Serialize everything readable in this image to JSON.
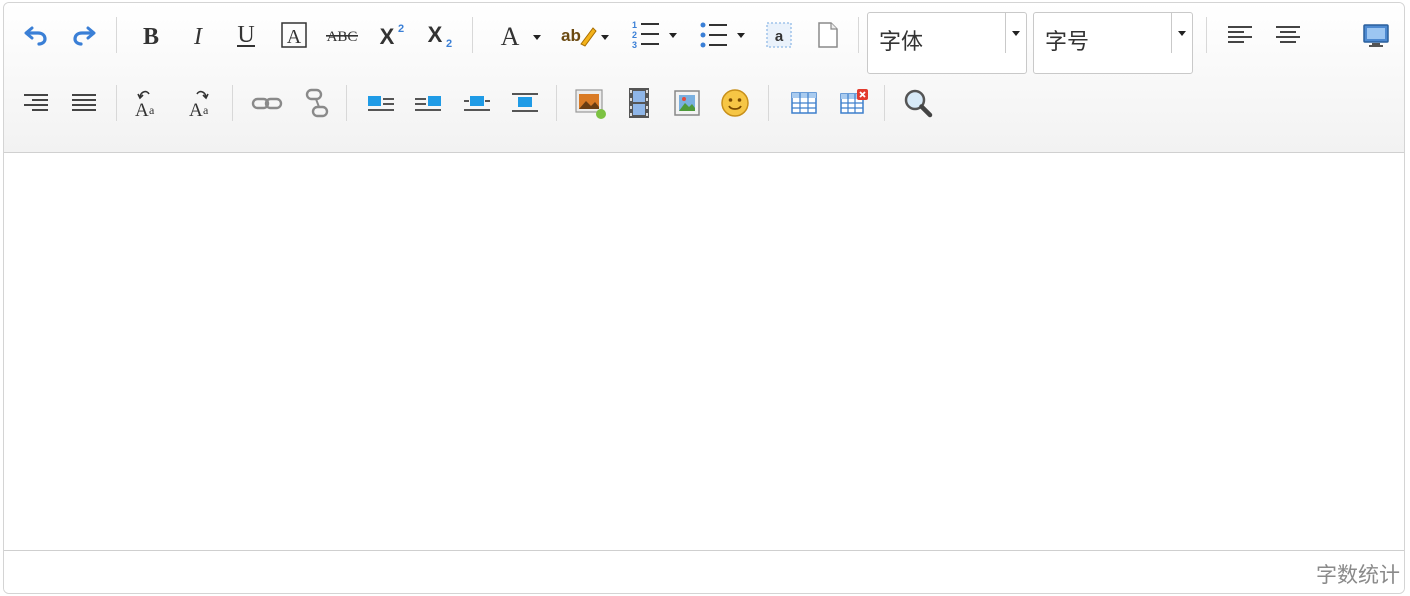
{
  "toolbar": {
    "buttons": [
      {
        "name": "undo-button",
        "icon": "undo-icon"
      },
      {
        "name": "redo-button",
        "icon": "redo-icon"
      },
      {
        "name": "bold-button",
        "icon": "bold-icon"
      },
      {
        "name": "italic-button",
        "icon": "italic-icon"
      },
      {
        "name": "underline-button",
        "icon": "underline-icon"
      },
      {
        "name": "font-border-button",
        "icon": "font-border-icon"
      },
      {
        "name": "strikethrough-button",
        "icon": "strikethrough-icon"
      },
      {
        "name": "superscript-button",
        "icon": "superscript-icon"
      },
      {
        "name": "subscript-button",
        "icon": "subscript-icon"
      },
      {
        "name": "font-color-button",
        "icon": "font-color-icon"
      },
      {
        "name": "highlight-color-button",
        "icon": "highlight-icon"
      },
      {
        "name": "ordered-list-button",
        "icon": "ordered-list-icon"
      },
      {
        "name": "unordered-list-button",
        "icon": "unordered-list-icon"
      },
      {
        "name": "paragraph-format-button",
        "icon": "paragraph-icon"
      },
      {
        "name": "paste-plain-button",
        "icon": "document-icon"
      },
      {
        "name": "align-left-button",
        "icon": "align-left-icon"
      },
      {
        "name": "align-center-button",
        "icon": "align-center-icon"
      },
      {
        "name": "fullscreen-button",
        "icon": "monitor-icon"
      },
      {
        "name": "align-right-button",
        "icon": "align-right-icon"
      },
      {
        "name": "align-justify-button",
        "icon": "align-justify-icon"
      },
      {
        "name": "text-direction-ltr-button",
        "icon": "text-ltr-icon"
      },
      {
        "name": "text-direction-rtl-button",
        "icon": "text-rtl-icon"
      },
      {
        "name": "link-button",
        "icon": "link-icon"
      },
      {
        "name": "unlink-button",
        "icon": "unlink-icon"
      },
      {
        "name": "image-float-left-button",
        "icon": "image-left-icon"
      },
      {
        "name": "image-float-right-button",
        "icon": "image-right-icon"
      },
      {
        "name": "image-inline-button",
        "icon": "image-inline-icon"
      },
      {
        "name": "image-center-button",
        "icon": "image-center-icon"
      },
      {
        "name": "insert-image-button",
        "icon": "image-icon"
      },
      {
        "name": "insert-video-button",
        "icon": "film-icon"
      },
      {
        "name": "insert-picture-button",
        "icon": "picture-icon"
      },
      {
        "name": "insert-emoticon-button",
        "icon": "smiley-icon"
      },
      {
        "name": "insert-table-button",
        "icon": "table-icon"
      },
      {
        "name": "delete-table-button",
        "icon": "table-delete-icon"
      },
      {
        "name": "search-replace-button",
        "icon": "magnifier-icon"
      }
    ],
    "font_family": {
      "label": "字体"
    },
    "font_size": {
      "label": "字号"
    }
  },
  "status_bar": {
    "word_count_label": "字数统计"
  },
  "colors": {
    "accent_blue": "#3a7fd6",
    "toolbar_bg": "#f4f4f4",
    "border": "#d4d4d4",
    "status_text": "#8a8a8a"
  }
}
